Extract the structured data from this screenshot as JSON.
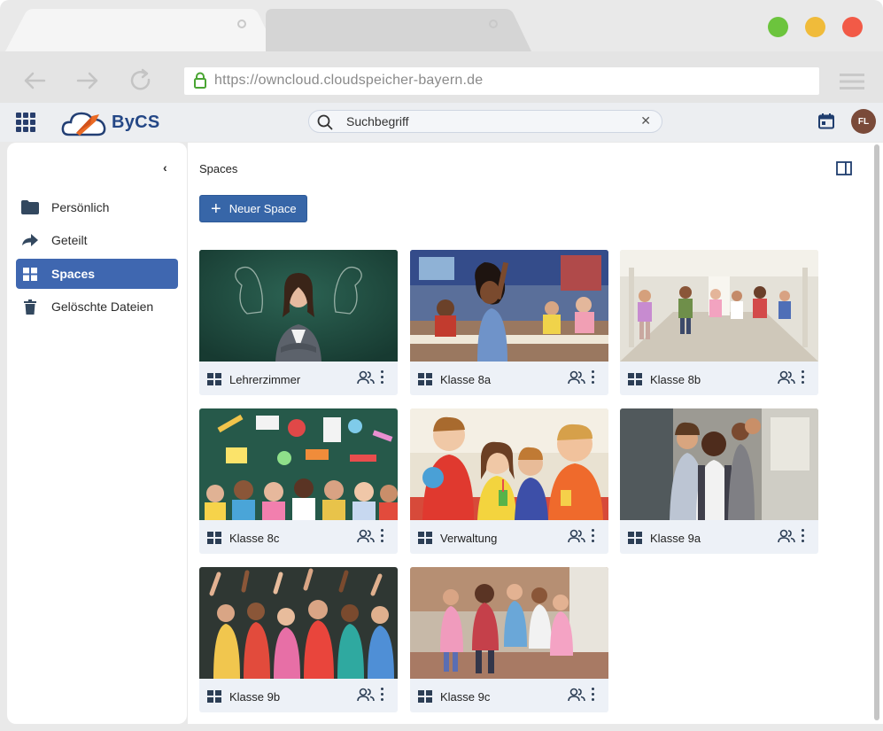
{
  "browser": {
    "url": "https://owncloud.cloudspeicher-bayern.de"
  },
  "header": {
    "logo_text": "ByCS",
    "search_value": "Suchbegriff",
    "avatar_initials": "FL"
  },
  "sidebar": {
    "items": [
      {
        "label": "Persönlich",
        "icon": "folder-icon"
      },
      {
        "label": "Geteilt",
        "icon": "share-icon"
      },
      {
        "label": "Spaces",
        "icon": "grid-icon",
        "active": true
      },
      {
        "label": "Gelöschte Dateien",
        "icon": "trash-icon"
      }
    ]
  },
  "main": {
    "title": "Spaces",
    "new_space_label": "Neuer Space",
    "spaces": [
      {
        "name": "Lehrerzimmer"
      },
      {
        "name": "Klasse 8a"
      },
      {
        "name": "Klasse 8b"
      },
      {
        "name": "Klasse 8c"
      },
      {
        "name": "Verwaltung"
      },
      {
        "name": "Klasse 9a"
      },
      {
        "name": "Klasse 9b"
      },
      {
        "name": "Klasse 9c"
      }
    ]
  },
  "colors": {
    "accent": "#3f67b0",
    "brand": "#244786",
    "traffic_green": "#6cc43d",
    "traffic_yellow": "#f0bb3a",
    "traffic_red": "#f25a47"
  }
}
